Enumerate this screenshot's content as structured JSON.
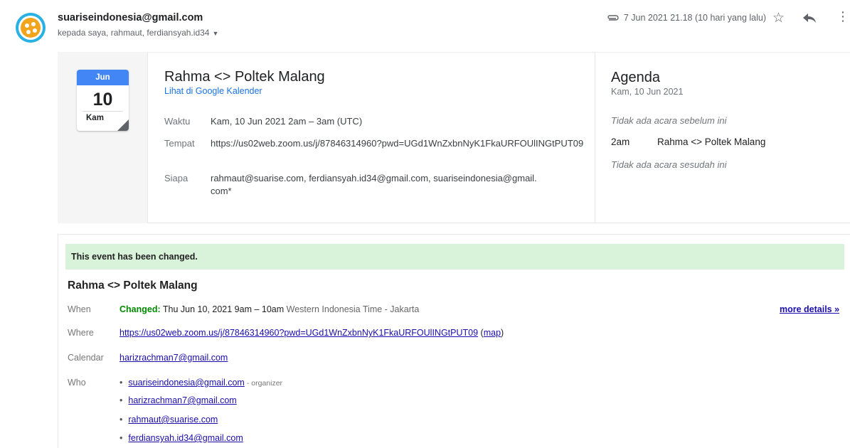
{
  "header": {
    "sender": "suariseindonesia@gmail.com",
    "recipients": "kepada saya, rahmaut, ferdiansyah.id34",
    "date": "7 Jun 2021 21.18 (10 hari yang lalu)",
    "icons": [
      "attachment-icon",
      "star-icon",
      "reply-icon",
      "more-vert-icon"
    ],
    "avatar_color": "#29b0e4"
  },
  "invite": {
    "cal_month": "Jun",
    "cal_day": "10",
    "cal_dow": "Kam",
    "title": "Rahma <> Poltek Malang",
    "gcal_link": "Lihat di Google Kalender",
    "rows": [
      {
        "label": "Waktu",
        "value": "Kam, 10 Jun 2021 2am – 3am (UTC)"
      },
      {
        "label": "Tempat",
        "value": "https://us02web.zoom.us/j/87846314960?pwd=UGd1WnZxbnNyK1FkaURFOUlINGtPUT09"
      },
      {
        "label": "Siapa",
        "value": "rahmaut@suarise.com, ferdiansyah.id34@gmail.com, suariseindonesia@gmail.com*"
      }
    ]
  },
  "agenda": {
    "title": "Agenda",
    "date": "Kam, 10 Jun 2021",
    "none_before": "Tidak ada acara sebelum ini",
    "event_time": "2am",
    "event_title": "Rahma <> Poltek Malang",
    "none_after": "Tidak ada acara sesudah ini"
  },
  "change": {
    "banner": "This event has been changed.",
    "title": "Rahma <> Poltek Malang",
    "when_label": "When",
    "changed_word": "Changed:",
    "when_value": "Thu Jun 10, 2021 9am – 10am",
    "when_tz": "Western Indonesia Time - Jakarta",
    "more_details": "more details »",
    "where_label": "Where",
    "where_link": "https://us02web.zoom.us/j/87846314960?pwd=UGd1WnZxbnNyK1FkaURFOUlINGtPUT09",
    "map_link": "map",
    "calendar_label": "Calendar",
    "calendar_value": "harizrachman7@gmail.com",
    "who_label": "Who",
    "who": [
      {
        "email": "suariseindonesia@gmail.com",
        "role": "- organizer"
      },
      {
        "email": "harizrachman7@gmail.com",
        "role": ""
      },
      {
        "email": "rahmaut@suarise.com",
        "role": ""
      },
      {
        "email": "ferdiansyah.id34@gmail.com",
        "role": ""
      }
    ],
    "banner_color": "#d9f2da",
    "changed_color": "#008800"
  }
}
